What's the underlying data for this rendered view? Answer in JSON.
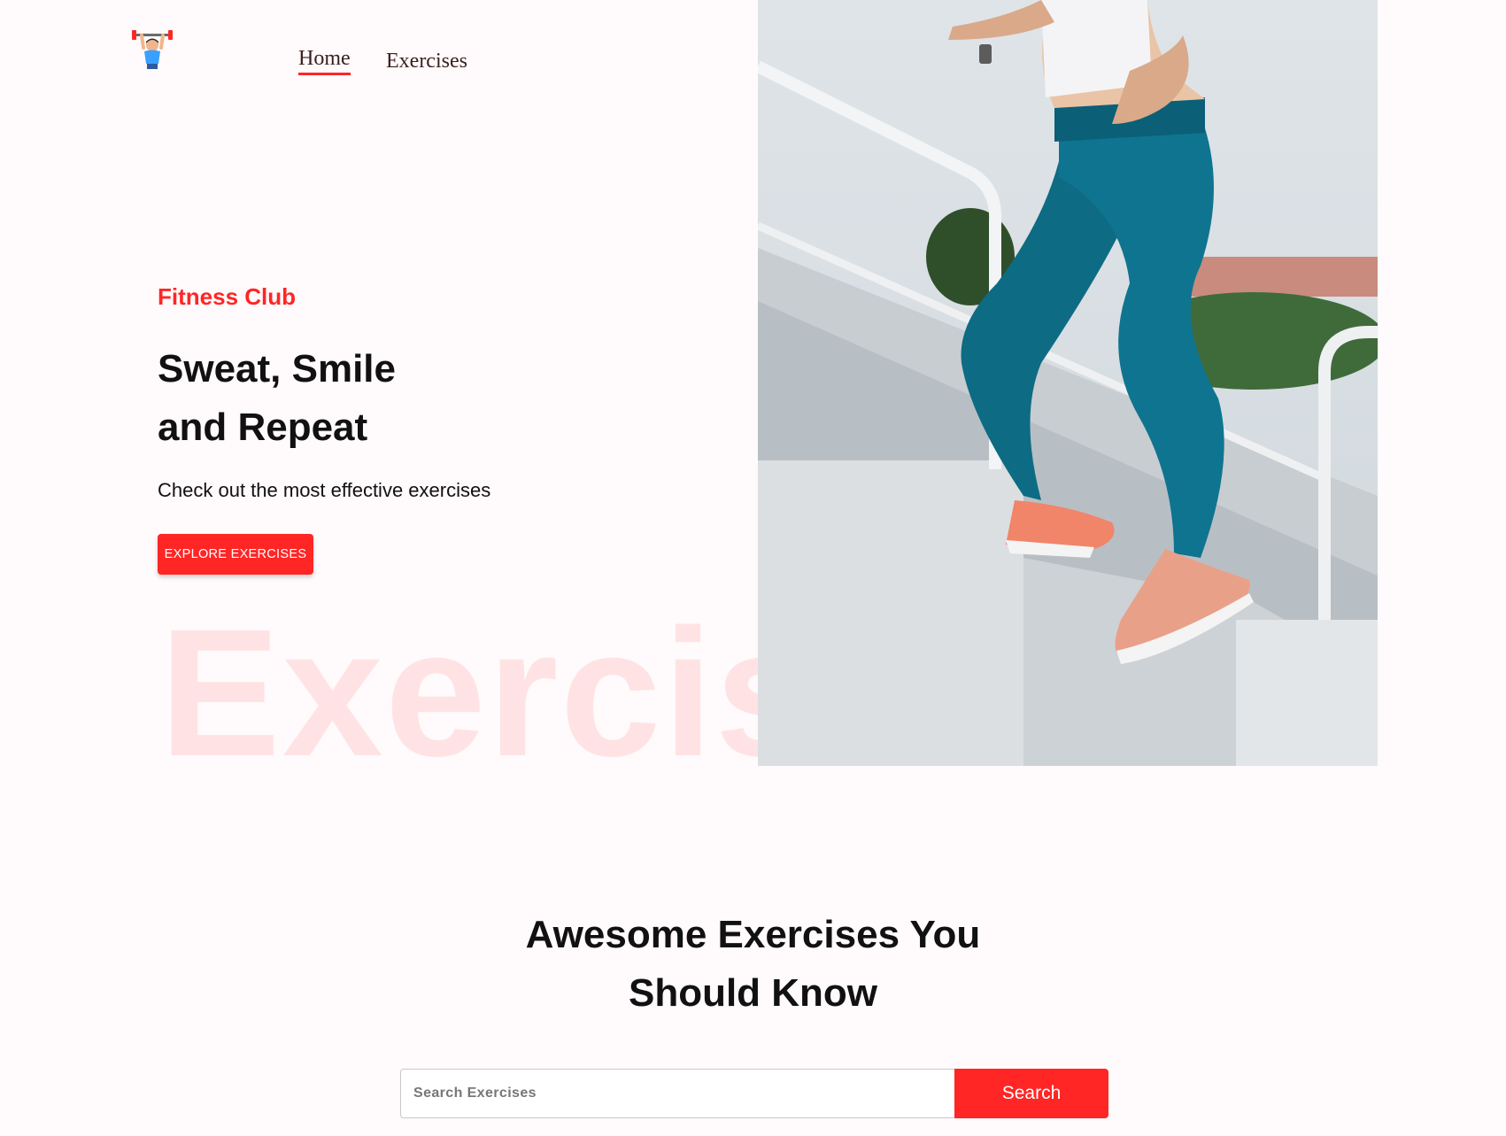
{
  "header": {
    "logo_icon": "weightlifter-logo-icon",
    "nav": [
      {
        "label": "Home",
        "active": true
      },
      {
        "label": "Exercises",
        "active": false
      }
    ]
  },
  "hero": {
    "kicker": "Fitness Club",
    "title_line1": "Sweat, Smile",
    "title_line2": "and Repeat",
    "subtitle": "Check out the most effective exercises",
    "button_label": "EXPLORE EXERCISES",
    "watermark": "Exercises",
    "image_icon": "woman-running-stairs-photo"
  },
  "search_section": {
    "title_line1": "Awesome Exercises You",
    "title_line2": "Should Know",
    "input_placeholder": "Search Exercises",
    "input_value": "",
    "button_label": "Search"
  },
  "colors": {
    "accent": "#ff2625",
    "background": "#fffafb",
    "text": "#111111",
    "nav_text": "#3a1f1f"
  }
}
